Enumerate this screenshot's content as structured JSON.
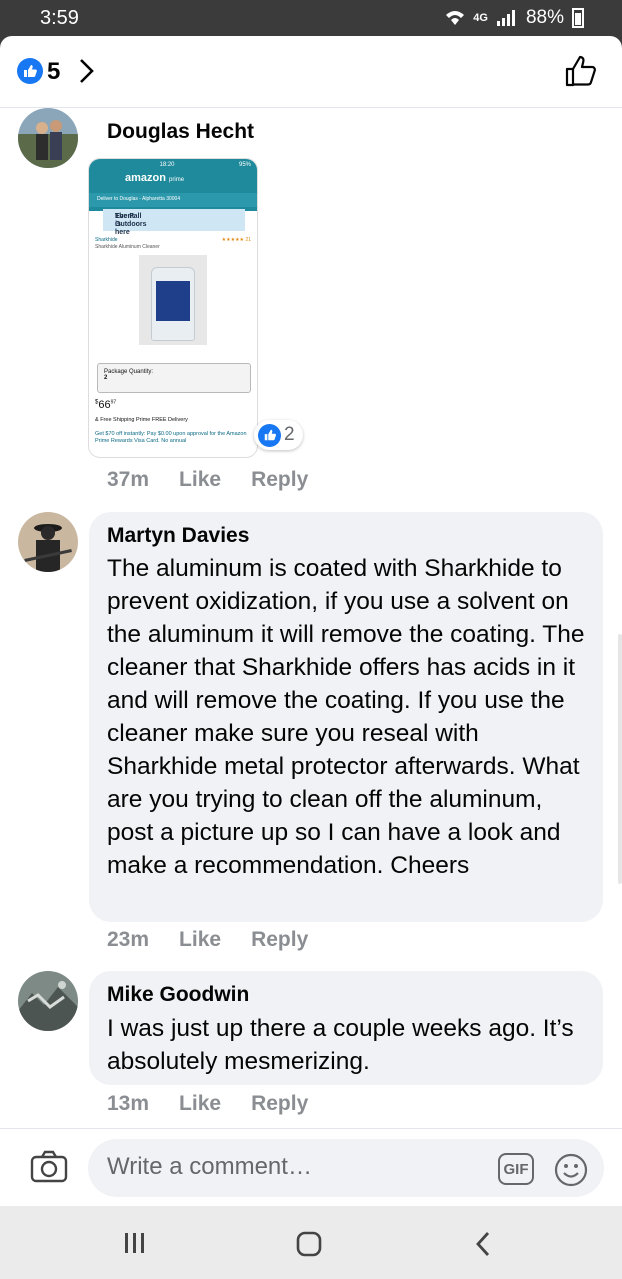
{
  "status_bar": {
    "time": "3:59",
    "network": "4G",
    "battery": "88%"
  },
  "reactions": {
    "count": "5"
  },
  "comments": [
    {
      "author": "Douglas Hecht",
      "time": "37m",
      "like": "Like",
      "reply": "Reply",
      "image_reactions": "2",
      "attachment": {
        "status_time": "18:20",
        "status_battery": "95%",
        "logo": "amazon",
        "logo_sub": "prime",
        "deliver_to": "Deliver to Douglas - Alpharetta 30004",
        "banner_line1": "The Fall Outdoors",
        "banner_line2": "Event is here",
        "brand": "Sharkhide",
        "product": "Sharkhide Aluminum Cleaner",
        "rating_count": "21",
        "package_label": "Package Quantity:",
        "package_value": "2",
        "price_sup": "$",
        "price_main": "66",
        "price_cents": "97",
        "shipping": "& Free Shipping Prime FREE Delivery",
        "promo": "Get $70 off instantly: Pay $0.00 upon approval for the Amazon Prime Rewards Visa Card. No annual"
      }
    },
    {
      "author": "Martyn Davies",
      "text": "The aluminum is coated with Sharkhide to prevent oxidization, if you use a solvent on the aluminum it will remove the coating.  The cleaner that Sharkhide offers has acids in it and will remove the coating. If you use the cleaner make sure you reseal with Sharkhide metal protector afterwards. What are you trying to clean off the aluminum, post a picture up so I can have a look and make a recommendation. Cheers",
      "time": "23m",
      "like": "Like",
      "reply": "Reply"
    },
    {
      "author": "Mike Goodwin",
      "text": "I was just up there a couple weeks ago. It’s absolutely mesmerizing.",
      "time": "13m",
      "like": "Like",
      "reply": "Reply"
    }
  ],
  "composer": {
    "placeholder": "Write a comment…",
    "gif_label": "GIF"
  },
  "colors": {
    "facebook_blue": "#1877f2",
    "bubble_gray": "#f0f2f5",
    "meta_gray": "#8a8d91"
  }
}
